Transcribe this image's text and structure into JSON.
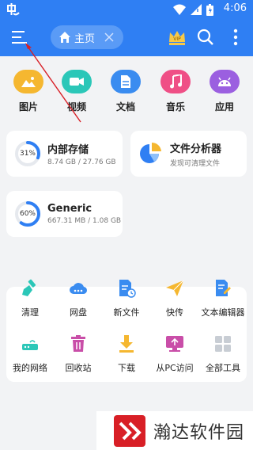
{
  "status_bar": {
    "time": "4:06"
  },
  "app_bar": {
    "home_tab_label": "主页",
    "menu_icon": "menu-icon",
    "vip_icon": "crown-icon",
    "search_icon": "search-icon",
    "more_icon": "more-vertical-icon"
  },
  "categories": [
    {
      "label": "图片",
      "icon": "image-icon",
      "color": "#f5b730"
    },
    {
      "label": "视频",
      "icon": "video-icon",
      "color": "#2bc7b8"
    },
    {
      "label": "文档",
      "icon": "document-icon",
      "color": "#3a8cf0"
    },
    {
      "label": "音乐",
      "icon": "music-icon",
      "color": "#ef4f86"
    },
    {
      "label": "应用",
      "icon": "android-icon",
      "color": "#9b5fe0"
    }
  ],
  "storage_internal": {
    "title": "内部存储",
    "usage": "8.74 GB / 27.76 GB",
    "percent_label": "31%",
    "percent": 31
  },
  "analyzer": {
    "title": "文件分析器",
    "subtitle": "发现可清理文件"
  },
  "storage_generic": {
    "title": "Generic",
    "usage": "667.31 MB / 1.08 GB",
    "percent_label": "60%",
    "percent": 60
  },
  "tools": [
    {
      "label": "清理",
      "icon": "broom-icon"
    },
    {
      "label": "网盘",
      "icon": "cloud-icon"
    },
    {
      "label": "新文件",
      "icon": "new-file-icon"
    },
    {
      "label": "快传",
      "icon": "paper-plane-icon"
    },
    {
      "label": "文本编辑器",
      "icon": "text-editor-icon"
    },
    {
      "label": "我的网络",
      "icon": "router-icon"
    },
    {
      "label": "回收站",
      "icon": "trash-icon"
    },
    {
      "label": "下载",
      "icon": "download-icon"
    },
    {
      "label": "从PC访问",
      "icon": "pc-access-icon"
    },
    {
      "label": "全部工具",
      "icon": "all-tools-icon"
    }
  ],
  "watermark": {
    "text": "瀚达软件园"
  }
}
